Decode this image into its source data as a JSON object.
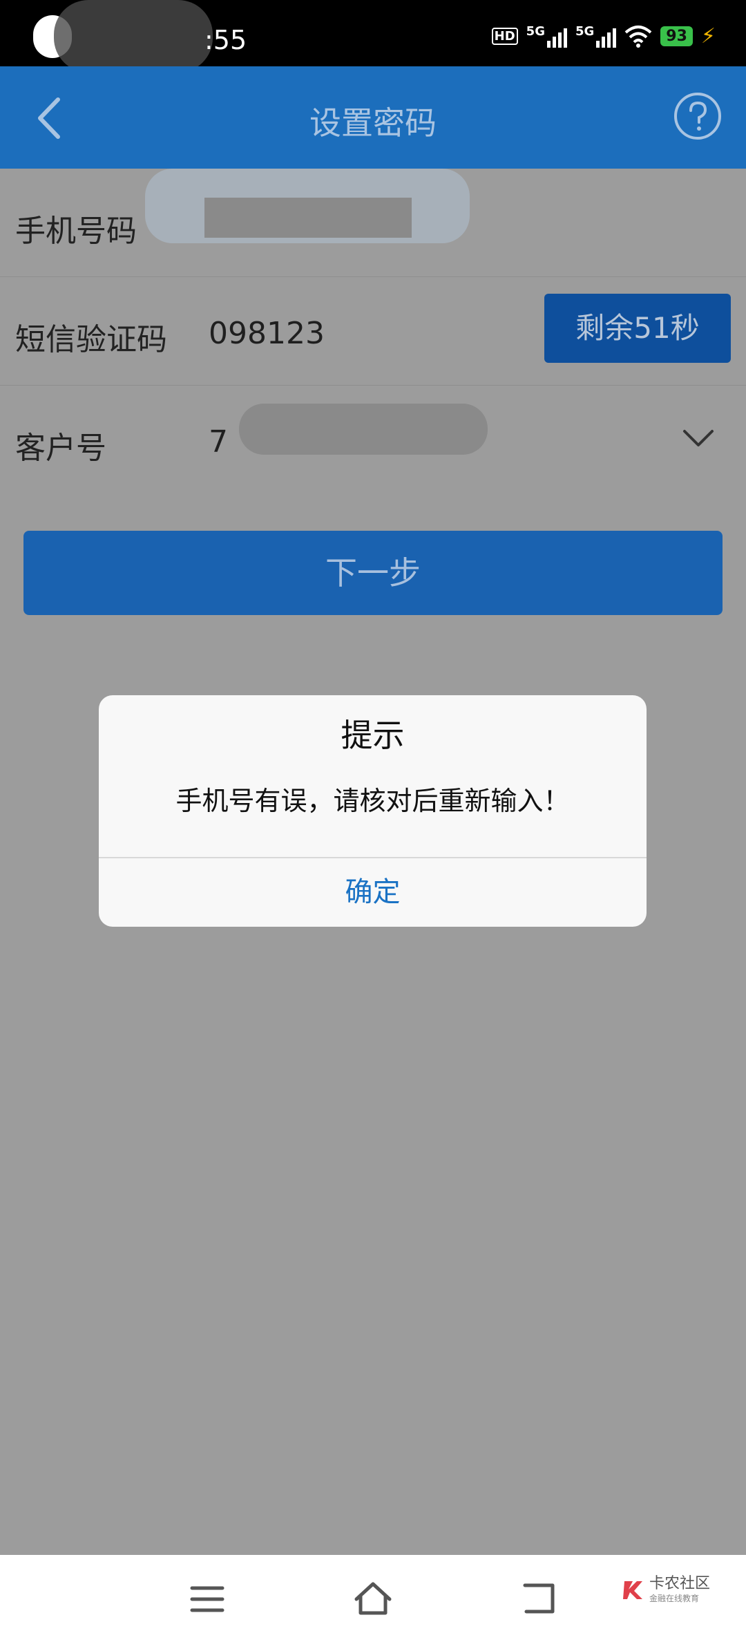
{
  "status_bar": {
    "time": ":55",
    "signal1_label": "5G",
    "signal2_label": "5G",
    "hd_label": "HD",
    "battery": "93"
  },
  "header": {
    "title": "设置密码"
  },
  "form": {
    "phone_label": "手机号码",
    "sms_label": "短信验证码",
    "sms_value": "098123",
    "timer_button": "剩余51秒",
    "customer_label": "客户号",
    "customer_value_partial": "7"
  },
  "next_button": "下一步",
  "dialog": {
    "title": "提示",
    "message": "手机号有误，请核对后重新输入！",
    "confirm": "确定"
  },
  "watermark": {
    "title": "卡农社区",
    "subtitle": "金融在线教育"
  },
  "colors": {
    "header": "#1c6ebc",
    "timer_button": "#0e4f9c",
    "dialog_link": "#1a72c4",
    "overlay_bg": "#9c9c9c"
  }
}
